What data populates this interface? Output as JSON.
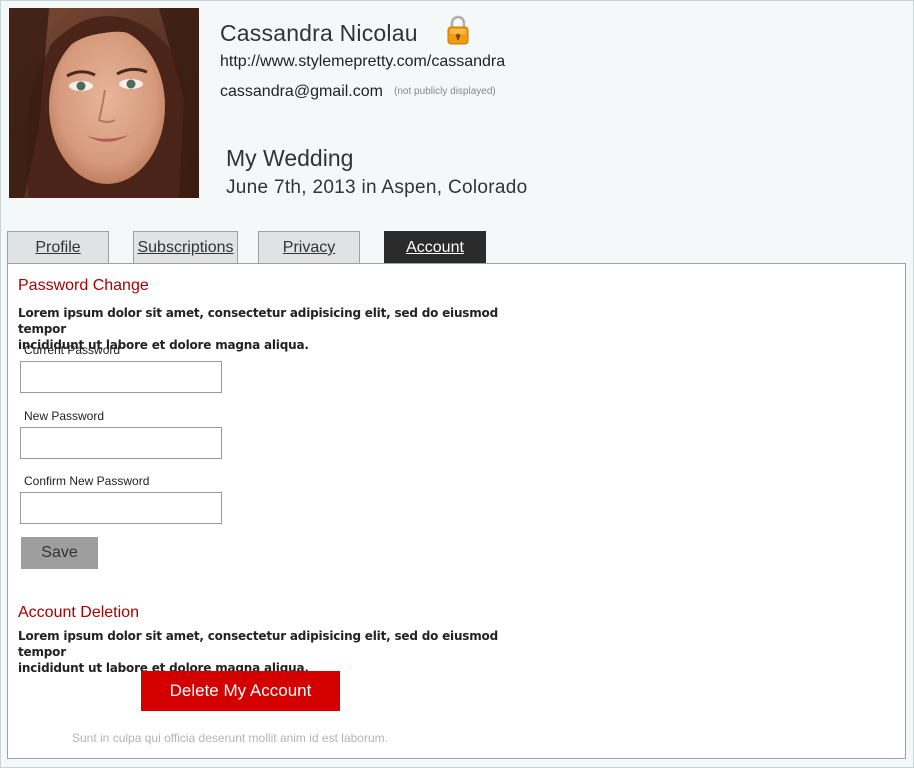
{
  "profile": {
    "name": "Cassandra Nicolau",
    "url": "http://www.stylemepretty.com/cassandra",
    "email": "cassandra@gmail.com",
    "email_note": "(not publicly displayed)",
    "wedding_title": "My Wedding",
    "wedding_details": "June 7th, 2013 in Aspen, Colorado"
  },
  "tabs": [
    {
      "label": "Profile",
      "active": false
    },
    {
      "label": "Subscriptions",
      "active": false
    },
    {
      "label": "Privacy",
      "active": false
    },
    {
      "label": "Account",
      "active": true
    }
  ],
  "password_change": {
    "title": "Password Change",
    "description_line1": "Lorem ipsum dolor sit amet, consectetur adipisicing elit, sed do eiusmod tempor",
    "description_line2": "incididunt ut labore et dolore magna aliqua.",
    "current_label": "Current Password",
    "current_value": "",
    "new_label": "New Password",
    "new_value": "",
    "confirm_label": "Confirm New Password",
    "confirm_value": "",
    "save_label": "Save"
  },
  "account_deletion": {
    "title": "Account Deletion",
    "description_line1": "Lorem ipsum dolor sit amet, consectetur adipisicing elit, sed do eiusmod tempor",
    "description_line2": "incididunt ut labore et dolore magna aliqua.",
    "delete_label": "Delete My Account",
    "footnote": "Sunt in culpa qui officia deserunt mollit anim id est laborum."
  },
  "colors": {
    "accent_red": "#d40000",
    "section_title": "#aa0000",
    "active_tab": "#2b2b2b",
    "lock": "#f29a10"
  },
  "icons": {
    "lock": "lock-icon"
  }
}
